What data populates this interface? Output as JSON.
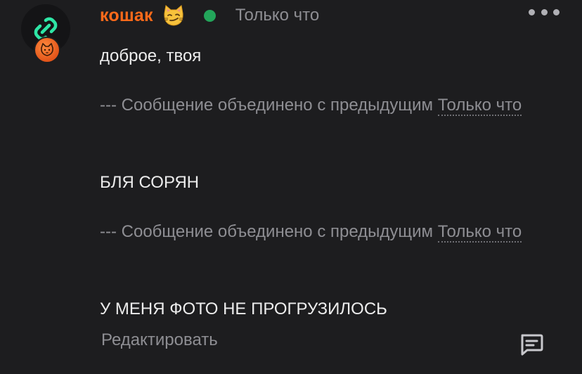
{
  "post": {
    "author": "кошак",
    "author_color": "#ff6a1a",
    "emoji_icon": "smirking-cat-emoji",
    "online_status_color": "#23a55a",
    "timestamp": "Только что",
    "avatar_icon": "link-chain-icon",
    "badge_icon": "cat-badge-icon",
    "menu_icon": "more-horizontal-icon"
  },
  "messages": [
    {
      "text": "доброе, твоя"
    },
    {
      "text": "БЛЯ СОРЯН"
    },
    {
      "text": "У МЕНЯ ФОТО НЕ ПРОГРУЗИЛОСЬ"
    }
  ],
  "merge_notices": [
    {
      "prefix": "--- Сообщение объединено с предыдущим",
      "time": "Только что"
    },
    {
      "prefix": "--- Сообщение объединено с предыдущим",
      "time": "Только что"
    }
  ],
  "footer": {
    "edit_label": "Редактировать",
    "comment_icon": "comment-icon"
  }
}
